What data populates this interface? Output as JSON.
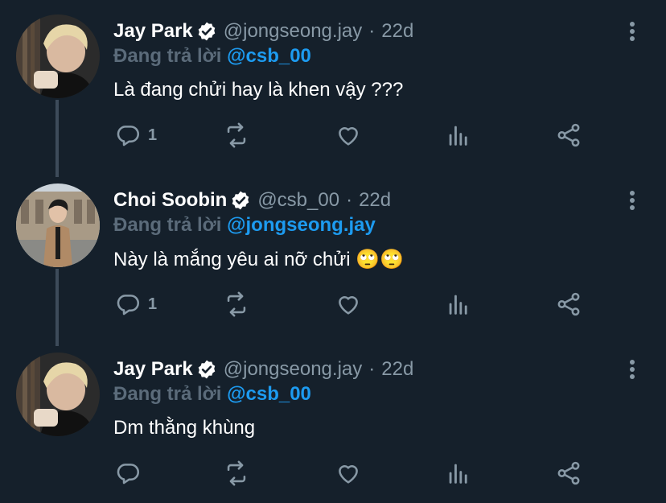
{
  "tweets": [
    {
      "name": "Jay Park",
      "handle": "@jongseong.jay",
      "separator": "·",
      "time": "22d",
      "reply_prefix": "Đang trả lời",
      "reply_to": "@csb_00",
      "text": "Là đang chửi hay là khen vậy ???",
      "reply_count": "1",
      "avatar": "blond-man-avatar"
    },
    {
      "name": "Choi Soobin",
      "handle": "@csb_00",
      "separator": "·",
      "time": "22d",
      "reply_prefix": "Đang trả lời",
      "reply_to": "@jongseong.jay",
      "text": "Này là mắng yêu ai nỡ chửi",
      "text_emoji": "🙄🙄",
      "reply_count": "1",
      "avatar": "man-in-coat-avatar"
    },
    {
      "name": "Jay Park",
      "handle": "@jongseong.jay",
      "separator": "·",
      "time": "22d",
      "reply_prefix": "Đang trả lời",
      "reply_to": "@csb_00",
      "text": "Dm thằng khùng",
      "reply_count": "",
      "avatar": "blond-man-avatar"
    }
  ],
  "icons": {
    "verified": "verified-badge-icon",
    "reply": "reply-icon",
    "retweet": "retweet-icon",
    "like": "heart-icon",
    "stats": "bar-chart-icon",
    "share": "share-icon",
    "more": "more-vertical-icon"
  },
  "colors": {
    "background": "#15202b",
    "link": "#1d9bf0",
    "muted": "#8899a6",
    "thread_line": "#3d4b5a"
  }
}
